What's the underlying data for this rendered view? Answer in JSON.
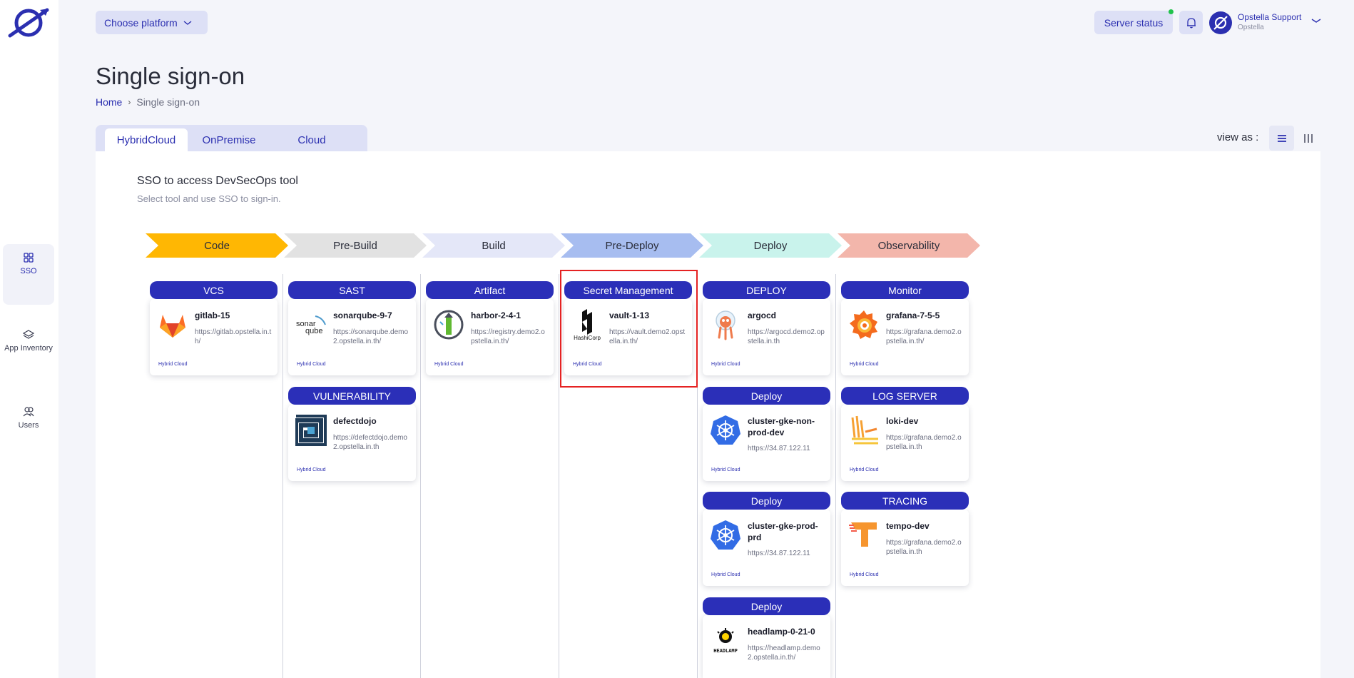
{
  "sidebar": {
    "items": [
      {
        "label": "SSO",
        "icon": "grid-icon",
        "active": true
      },
      {
        "label": "App Inventory",
        "icon": "layers-icon",
        "active": false
      },
      {
        "label": "Users",
        "icon": "users-icon",
        "active": false
      }
    ]
  },
  "topbar": {
    "platform_label": "Choose platform",
    "server_status_label": "Server status",
    "user_name": "Opstella Support",
    "user_org": "Opstella"
  },
  "page": {
    "title": "Single sign-on",
    "breadcrumb_home": "Home",
    "breadcrumb_current": "Single sign-on"
  },
  "tabs": [
    {
      "label": "HybridCloud",
      "active": true
    },
    {
      "label": "OnPremise",
      "active": false
    },
    {
      "label": "Cloud",
      "active": false
    }
  ],
  "view_as_label": "view as :",
  "section": {
    "title": "SSO to access DevSecOps tool",
    "subtitle": "Select tool and use SSO to sign-in."
  },
  "stages": [
    {
      "label": "Code",
      "color": "#ffb703"
    },
    {
      "label": "Pre-Build",
      "color": "#e2e2e2"
    },
    {
      "label": "Build",
      "color": "#e4e7f8"
    },
    {
      "label": "Pre-Deploy",
      "color": "#a7bdf0"
    },
    {
      "label": "Deploy",
      "color": "#c9f3ec"
    },
    {
      "label": "Observability",
      "color": "#f3b6ab"
    }
  ],
  "tag_label": "Hybrid Cloud",
  "cards": [
    {
      "category": "VCS",
      "name": "gitlab-15",
      "url": "https://gitlab.opstella.in.th/",
      "icon": "gitlab-icon"
    },
    {
      "category": "SAST",
      "name": "sonarqube-9-7",
      "url": "https://sonarqube.demo2.opstella.in.th/",
      "icon": "sonarqube-icon"
    },
    {
      "category": "VULNERABILITY",
      "name": "defectdojo",
      "url": "https://defectdojo.demo2.opstella.in.th",
      "icon": "defectdojo-icon"
    },
    {
      "category": "Artifact",
      "name": "harbor-2-4-1",
      "url": "https://registry.demo2.opstella.in.th/",
      "icon": "harbor-icon"
    },
    {
      "category": "Secret Management",
      "name": "vault-1-13",
      "url": "https://vault.demo2.opstella.in.th/",
      "icon": "hashicorp-icon"
    },
    {
      "category": "DEPLOY",
      "name": "argocd",
      "url": "https://argocd.demo2.opstella.in.th",
      "icon": "argocd-icon"
    },
    {
      "category": "Deploy",
      "name": "cluster-gke-non-prod-dev",
      "url": "https://34.87.122.11",
      "icon": "kubernetes-icon"
    },
    {
      "category": "Deploy",
      "name": "cluster-gke-prod-prd",
      "url": "https://34.87.122.11",
      "icon": "kubernetes-icon"
    },
    {
      "category": "Deploy",
      "name": "headlamp-0-21-0",
      "url": "https://headlamp.demo2.opstella.in.th/",
      "icon": "headlamp-icon"
    },
    {
      "category": "Monitor",
      "name": "grafana-7-5-5",
      "url": "https://grafana.demo2.opstella.in.th/",
      "icon": "grafana-icon"
    },
    {
      "category": "LOG SERVER",
      "name": "loki-dev",
      "url": "https://grafana.demo2.opstella.in.th",
      "icon": "loki-icon"
    },
    {
      "category": "TRACING",
      "name": "tempo-dev",
      "url": "https://grafana.demo2.opstella.in.th",
      "icon": "tempo-icon"
    }
  ],
  "icon_text": {
    "sonar_a": "sonar",
    "sonar_b": "qube",
    "hashicorp": "HashiCorp",
    "headlamp": "HEADLAMP"
  },
  "colors": {
    "accent": "#2b2fb0",
    "card_header": "#2b2fb8",
    "highlight": "#e52222"
  }
}
